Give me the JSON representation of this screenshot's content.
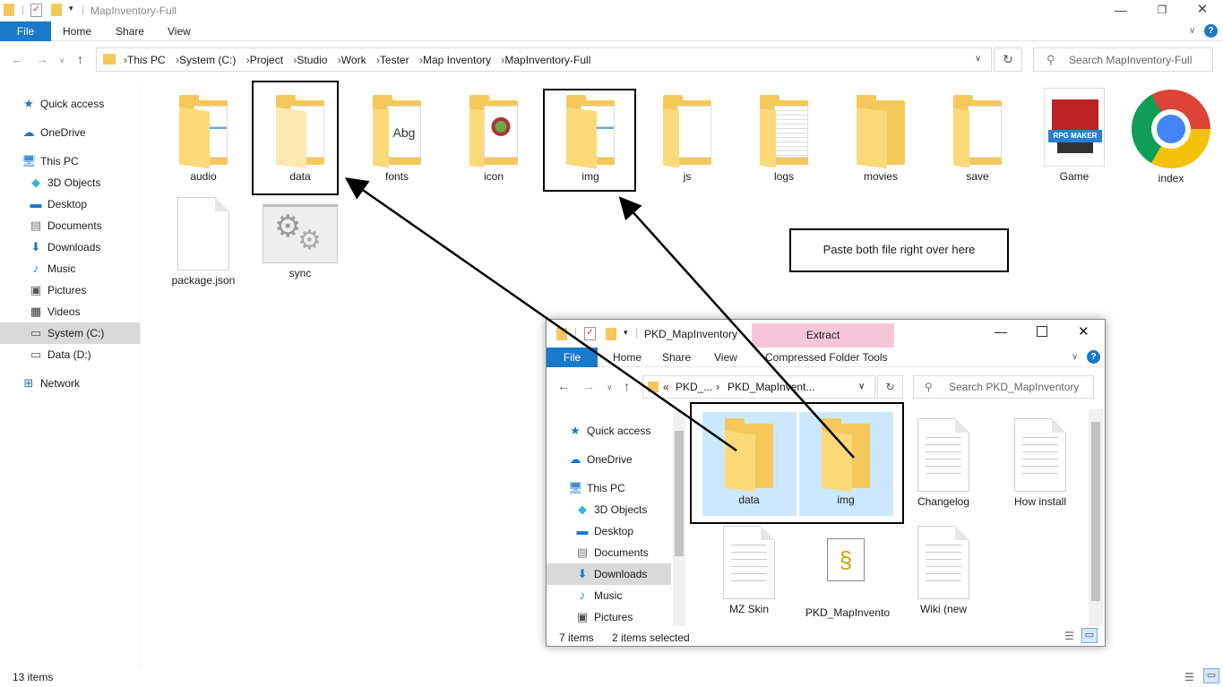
{
  "main": {
    "title": "MapInventory-Full",
    "tabs": [
      "File",
      "Home",
      "Share",
      "View"
    ],
    "breadcrumb": [
      "This PC",
      "System (C:)",
      "Project",
      "Studio",
      "Work",
      "Tester",
      "Map Inventory",
      "MapInventory-Full"
    ],
    "search_placeholder": "Search MapInventory-Full",
    "sidebar": [
      {
        "label": "Quick access",
        "icon": "star-icon"
      },
      {
        "label": "OneDrive",
        "icon": "cloud-icon"
      },
      {
        "label": "This PC",
        "icon": "computer-icon"
      },
      {
        "label": "3D Objects",
        "icon": "cube-icon"
      },
      {
        "label": "Desktop",
        "icon": "desktop-icon"
      },
      {
        "label": "Documents",
        "icon": "document-icon"
      },
      {
        "label": "Downloads",
        "icon": "download-icon"
      },
      {
        "label": "Music",
        "icon": "music-icon"
      },
      {
        "label": "Pictures",
        "icon": "picture-icon"
      },
      {
        "label": "Videos",
        "icon": "video-icon"
      },
      {
        "label": "System (C:)",
        "icon": "drive-icon"
      },
      {
        "label": "Data (D:)",
        "icon": "drive-icon"
      },
      {
        "label": "Network",
        "icon": "network-icon"
      }
    ],
    "items": [
      "audio",
      "data",
      "fonts",
      "icon",
      "img",
      "js",
      "logs",
      "movies",
      "save",
      "Game",
      "index",
      "package.json",
      "sync"
    ],
    "status": "13 items"
  },
  "annotation": "Paste both file right over here",
  "inner": {
    "title": "PKD_MapInventory",
    "context_tab": "Extract",
    "tabs": [
      "File",
      "Home",
      "Share",
      "View",
      "Compressed Folder Tools"
    ],
    "breadcrumb": [
      "PKD_...",
      "PKD_MapInvent..."
    ],
    "breadcrumb_prefix": "«",
    "search_placeholder": "Search PKD_MapInventory",
    "sidebar": [
      "Quick access",
      "OneDrive",
      "This PC",
      "3D Objects",
      "Desktop",
      "Documents",
      "Downloads",
      "Music",
      "Pictures"
    ],
    "items": [
      "data",
      "img",
      "Changelog",
      "How install",
      "MZ Skin",
      "PKD_MapInvento",
      "Wiki (new"
    ],
    "status_count": "7 items",
    "status_selected": "2 items selected"
  },
  "colors": {
    "accent": "#1979ca",
    "folder": "#f4c85a",
    "selection": "#cce8ff",
    "extract_tab": "#f7c5d8"
  }
}
